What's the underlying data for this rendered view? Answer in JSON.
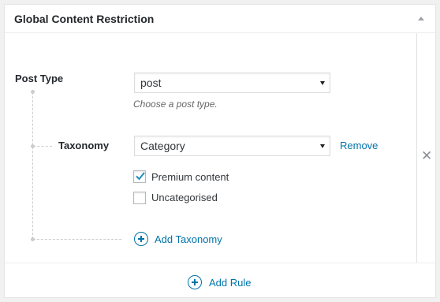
{
  "panel": {
    "title": "Global Content Restriction"
  },
  "rule": {
    "post_type": {
      "label": "Post Type",
      "selected": "post",
      "description": "Choose a post type."
    },
    "taxonomy": {
      "label": "Taxonomy",
      "selected": "Category",
      "remove_label": "Remove",
      "terms": [
        {
          "label": "Premium content",
          "checked": true
        },
        {
          "label": "Uncategorised",
          "checked": false
        }
      ]
    },
    "add_taxonomy_label": "Add Taxonomy",
    "remove_rule_icon": "close-icon"
  },
  "footer": {
    "add_rule_label": "Add Rule"
  },
  "colors": {
    "link": "#0073aa",
    "connector": "#cccccc"
  }
}
